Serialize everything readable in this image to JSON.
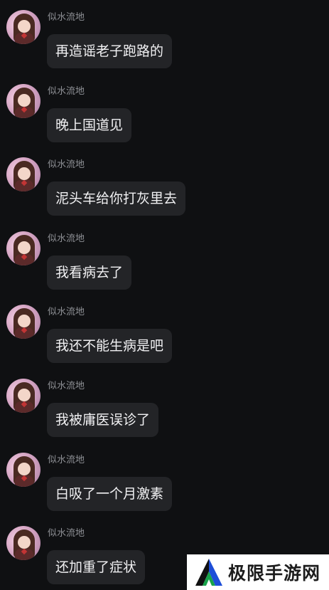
{
  "messages": [
    {
      "sender": "似水流地",
      "text": "再造谣老子跑路的"
    },
    {
      "sender": "似水流地",
      "text": "晚上国道见"
    },
    {
      "sender": "似水流地",
      "text": "泥头车给你打灰里去"
    },
    {
      "sender": "似水流地",
      "text": "我看病去了"
    },
    {
      "sender": "似水流地",
      "text": "我还不能生病是吧"
    },
    {
      "sender": "似水流地",
      "text": "我被庸医误诊了"
    },
    {
      "sender": "似水流地",
      "text": "白吸了一个月激素"
    },
    {
      "sender": "似水流地",
      "text": "还加重了症状"
    }
  ],
  "watermark": {
    "text": "极限手游网",
    "logo_icon": "mountain-logo-icon",
    "colors": {
      "green": "#17a34a",
      "blue": "#1d4ed8",
      "black": "#111111"
    }
  },
  "colors": {
    "background": "#0f1012",
    "bubble": "#232427",
    "sender_text": "#8f9196",
    "message_text": "#f1f1f3"
  }
}
